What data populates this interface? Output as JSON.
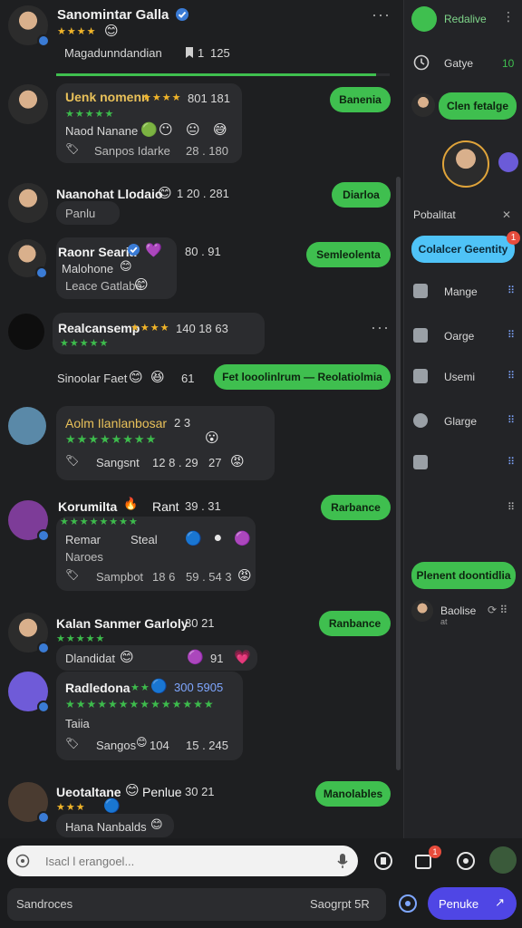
{
  "header": {
    "title": "Sanomintar Galla",
    "stars": "★★★★",
    "subtitle": "Magadunndandian",
    "count_a": "1",
    "count_b": "125"
  },
  "sidebar": {
    "top_label": "Redalive",
    "row1_label": "Gatye",
    "row1_value": "10",
    "green_pill": "Clen fetalge",
    "section_label": "Pobalitat",
    "close_symbol": "✕",
    "blue_pill": "Colalcer Geentity",
    "blue_badge": "1",
    "items": [
      {
        "icon": "home-icon",
        "label": "Mange"
      },
      {
        "icon": "lock-icon",
        "label": "Oarge"
      },
      {
        "icon": "grid-icon",
        "label": "Usemi"
      },
      {
        "icon": "chat-icon",
        "label": "Glarge"
      }
    ],
    "bottom_pill": "Plenent doontidlia",
    "bottom_user": "Baolise",
    "bottom_user_sub": "at"
  },
  "messages": [
    {
      "name": "Uenk nomenn",
      "stars": "★★★★★",
      "line1": "Naod Nanane",
      "line2": "Sanpos Idarke",
      "numbers": "801 181",
      "numbers2": "28 . 180",
      "action": "Banenia"
    },
    {
      "name": "Naanohat Llodaio",
      "numbers": "1 20 . 281",
      "line1": "Panlu",
      "action": "Diarloa"
    },
    {
      "name": "Raonr Searia",
      "numbers": "80 . 91",
      "line1": "Malohone",
      "line2": "Leace Gatlabe",
      "action": "Semleolenta"
    },
    {
      "name": "Realcansemp",
      "stars": "★★★★",
      "numbers": "140 18 63",
      "line1": "Sinoolar Faet",
      "line1_num": "61",
      "action": "Fet looolinlrum — Reolatiolmia"
    },
    {
      "name": "Aolm Ilanlanbosar",
      "numbers": "2 3",
      "stars": "★★★★★★★★",
      "line2": "Sangsnt",
      "numbers2": "12 8 . 29",
      "numbers3": "27"
    },
    {
      "name": "Korumilta",
      "name_suffix": "Rant",
      "numbers": "39 . 31",
      "stars": "★★★★★★★★",
      "line1": "Remar",
      "line1_b": "Steal",
      "line2": "Naroes",
      "line3": "Sampbot",
      "numbers2": "18 6",
      "numbers3": "59 . 54 3",
      "action": "Rarbance"
    },
    {
      "name": "Kalan Sanmer Garloly",
      "numbers": "30 21",
      "stars": "★★★★★",
      "line1": "Dlandidat",
      "line1_num": "91",
      "action": "Ranbance"
    },
    {
      "name": "Radledona",
      "numbers": "300 5905",
      "stars": "★★★★★★★★★★★★★★",
      "line1": "Taiia",
      "line2": "Sangos",
      "numbers2": "104",
      "numbers3": "15 . 245"
    },
    {
      "name": "Ueotaltane",
      "name_suffix": "Penlue",
      "numbers": "30 21",
      "stars": "★★★",
      "line1": "Hana Nanbalds",
      "action": "Manolables"
    }
  ],
  "composer": {
    "placeholder": "Isacl l erangoel..."
  },
  "footer": {
    "left_label": "Sandroces",
    "right_label": "Saogrpt 5R",
    "primary_button": "Penuke",
    "notify_badge": "1"
  },
  "colors": {
    "accent_green": "#3fbf4f",
    "accent_blue": "#4fa3ff",
    "primary_button": "#4f46e5"
  },
  "progress_fraction": 0.96
}
